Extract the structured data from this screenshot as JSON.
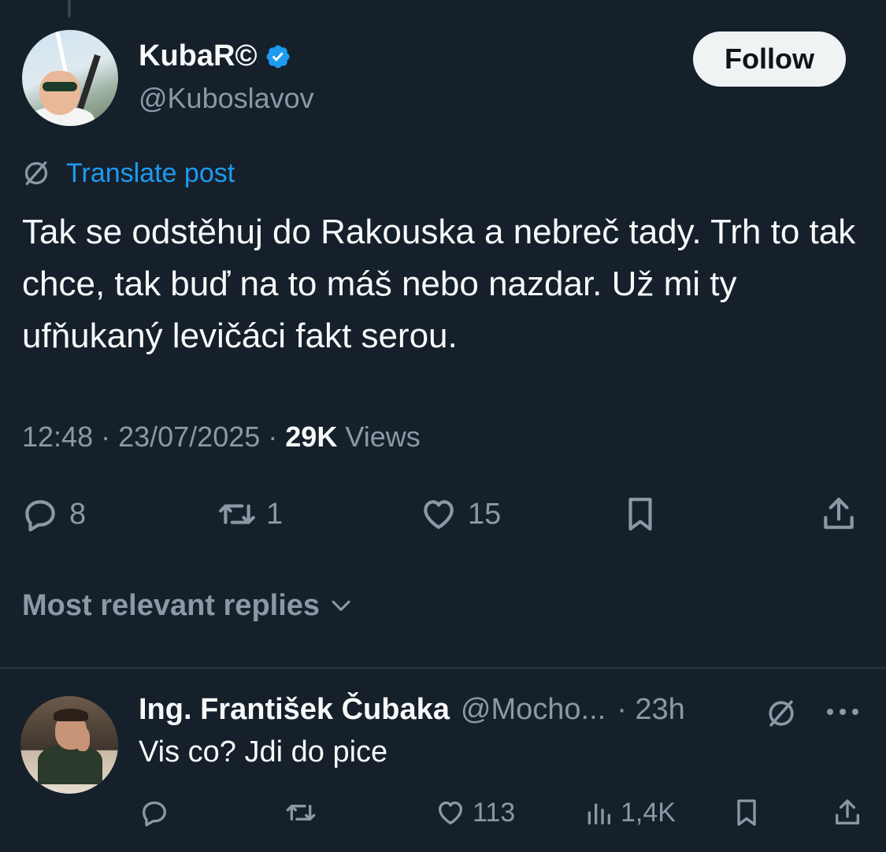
{
  "post": {
    "author_name": "KubaR©",
    "author_handle": "@Kuboslavov",
    "follow_label": "Follow",
    "translate_label": "Translate post",
    "text": "Tak se odstěhuj do Rakouska a nebreč tady. Trh to tak chce, tak buď na to máš nebo nazdar. Už mi ty ufňukaný levičáci fakt serou.",
    "time": "12:48",
    "date": "23/07/2025",
    "views_count": "29K",
    "views_label": "Views",
    "separator": "·",
    "replies_count": "8",
    "reposts_count": "1",
    "likes_count": "15"
  },
  "sort_label": "Most relevant replies",
  "reply": {
    "author_name": "Ing. František Čubaka",
    "author_handle": "@Mocho...",
    "time": "· 23h",
    "text": "Vis co? Jdi do pice",
    "likes_count": "113",
    "views_count": "1,4K"
  },
  "icons": {
    "verified": "verified-badge-icon",
    "translate": "translate-icon",
    "reply": "reply-icon",
    "repost": "repost-icon",
    "like": "like-icon",
    "bookmark": "bookmark-icon",
    "share": "share-icon",
    "chevron": "chevron-down-icon",
    "more": "more-icon",
    "views": "views-icon"
  },
  "colors": {
    "background": "#15202b",
    "accent": "#1d9bf0",
    "muted": "#8b98a5"
  }
}
